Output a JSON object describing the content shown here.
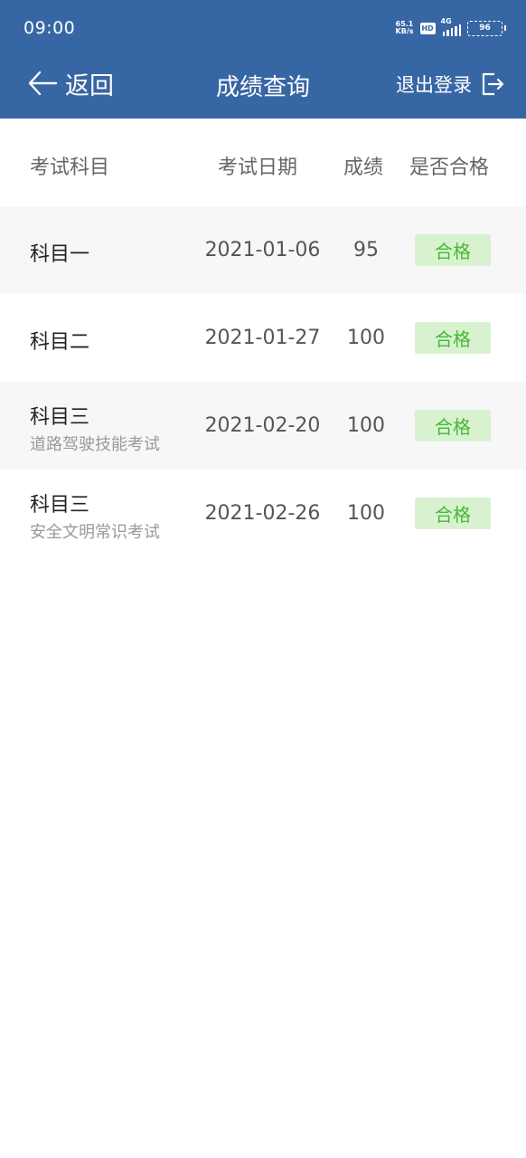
{
  "status_bar": {
    "time": "09:00",
    "net_speed_value": "65.1",
    "net_speed_unit": "KB/s",
    "hd": "HD",
    "network": "4G",
    "battery": "96"
  },
  "nav": {
    "back_label": "返回",
    "title": "成绩查询",
    "logout_label": "退出登录"
  },
  "table": {
    "headers": {
      "subject": "考试科目",
      "date": "考试日期",
      "score": "成绩",
      "passed": "是否合格"
    },
    "rows": [
      {
        "subject": "科目一",
        "subtitle": "",
        "date": "2021-01-06",
        "score": "95",
        "status": "合格"
      },
      {
        "subject": "科目二",
        "subtitle": "",
        "date": "2021-01-27",
        "score": "100",
        "status": "合格"
      },
      {
        "subject": "科目三",
        "subtitle": "道路驾驶技能考试",
        "date": "2021-02-20",
        "score": "100",
        "status": "合格"
      },
      {
        "subject": "科目三",
        "subtitle": "安全文明常识考试",
        "date": "2021-02-26",
        "score": "100",
        "status": "合格"
      }
    ]
  },
  "colors": {
    "header_bg": "#3766a4",
    "pass_bg": "#d8f2d0",
    "pass_text": "#45b834",
    "alt_row_bg": "#f7f7f7"
  }
}
